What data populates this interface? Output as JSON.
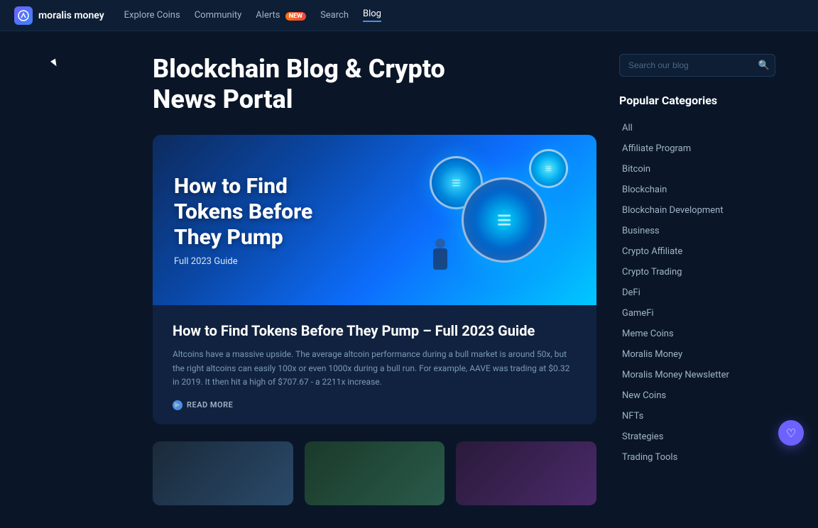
{
  "brand": {
    "name": "moralis money",
    "logo_icon": "M"
  },
  "nav": {
    "links": [
      {
        "label": "Explore Coins",
        "active": false
      },
      {
        "label": "Community",
        "active": false
      },
      {
        "label": "Alerts",
        "badge": "NEW",
        "active": false
      },
      {
        "label": "Search",
        "active": false
      },
      {
        "label": "Blog",
        "active": true
      }
    ]
  },
  "page": {
    "title_line1": "Blockchain Blog & Crypto",
    "title_line2": "News Portal"
  },
  "featured_article": {
    "image_title": "How to Find Tokens Before They Pump",
    "image_subtitle": "Full 2023 Guide",
    "title": "How to Find Tokens Before They Pump – Full 2023 Guide",
    "excerpt": "Altcoins have a massive upside. The average altcoin performance during a bull market is around 50x, but the right altcoins can easily 100x or even 1000x during a bull run. For example, AAVE was trading at $0.32 in 2019. It then hit a high of $707.67 - a 2211x increase.",
    "read_more_label": "READ MORE"
  },
  "search": {
    "placeholder": "Search our blog"
  },
  "categories": {
    "title": "Popular Categories",
    "items": [
      {
        "label": "All"
      },
      {
        "label": "Affiliate Program"
      },
      {
        "label": "Bitcoin"
      },
      {
        "label": "Blockchain"
      },
      {
        "label": "Blockchain Development"
      },
      {
        "label": "Business"
      },
      {
        "label": "Crypto Affiliate"
      },
      {
        "label": "Crypto Trading"
      },
      {
        "label": "DeFi"
      },
      {
        "label": "GameFi"
      },
      {
        "label": "Meme Coins"
      },
      {
        "label": "Moralis Money"
      },
      {
        "label": "Moralis Money Newsletter"
      },
      {
        "label": "New Coins"
      },
      {
        "label": "NFTs"
      },
      {
        "label": "Strategies"
      },
      {
        "label": "Trading Tools"
      }
    ]
  },
  "chat_icon": "♡"
}
